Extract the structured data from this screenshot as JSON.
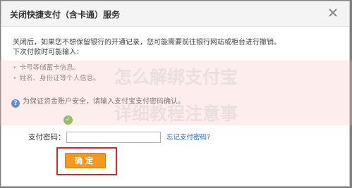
{
  "dialog": {
    "title": "关闭快捷支付（含卡通）服务",
    "close_icon": "close-icon",
    "description_line1": "关闭后，如果您不想保留银行的开通记录，您可能需要前往银行网站或柜台进行撤销。",
    "description_line2": "下次付款时可能输入：",
    "requirements": [
      "卡号等储蓄卡信息。",
      "姓名、身份证等个人信息。"
    ],
    "notice_text": "为保证资金账户安全，请输入支付宝支付密码确认。",
    "check_text": "",
    "password_label": "支付密码：",
    "password_value": "",
    "forgot_link": "忘记支付密码?",
    "confirm_button": "确定"
  },
  "watermark": {
    "line1": "怎么解绑支付宝",
    "line2": "详细教程注意事"
  },
  "colors": {
    "confirm_bg": "#f39a1e",
    "highlight_border": "#d12a2a",
    "link": "#1a64c7"
  }
}
